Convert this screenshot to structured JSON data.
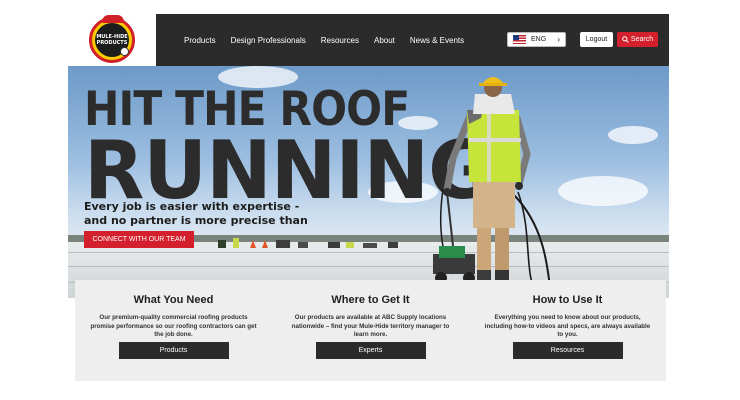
{
  "brand": {
    "logo_text_line1": "MULE-HIDE",
    "logo_text_line2": "PRODUCTS"
  },
  "nav": {
    "items": [
      {
        "label": "Products"
      },
      {
        "label": "Design Professionals"
      },
      {
        "label": "Resources"
      },
      {
        "label": "About"
      },
      {
        "label": "News & Events"
      }
    ],
    "language": "ENG",
    "logout_label": "Logout",
    "search_label": "Search"
  },
  "hero": {
    "title_line1": "HIT THE ROOF",
    "title_line2": "RUNNING",
    "subtitle": "Every job is easier with expertise - and no partner is more precise than us.",
    "cta_label": "CONNECT WITH OUR TEAM"
  },
  "cards": [
    {
      "title": "What You Need",
      "text": "Our premium-quality commercial roofing products promise performance so our roofing contractors can get the job done.",
      "button": "Products"
    },
    {
      "title": "Where to Get It",
      "text": "Our products are available at ABC Supply locations nationwide – find your Mule-Hide territory manager to learn more.",
      "button": "Experts"
    },
    {
      "title": "How to Use It",
      "text": "Everything you need to know about our products, including how-to videos and specs, are always available to you.",
      "button": "Resources"
    }
  ],
  "colors": {
    "nav_bg": "#2b2b2b",
    "accent_red": "#d4202c",
    "card_bg": "#eeeeee",
    "vest_yellow": "#c6e43a"
  },
  "icons": [
    "us-flag-icon",
    "chevron-right-icon",
    "search-icon"
  ]
}
